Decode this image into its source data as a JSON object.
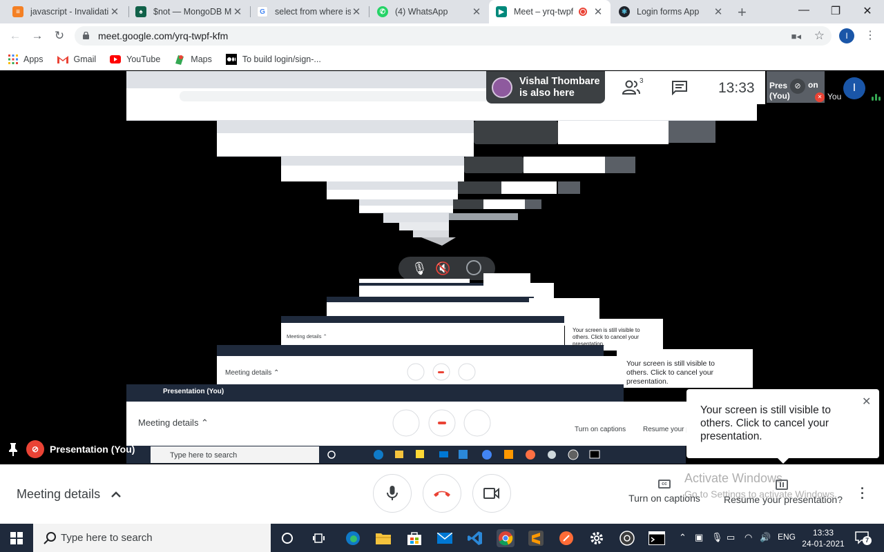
{
  "browser": {
    "tabs": [
      {
        "title": "javascript - Invalidati",
        "icon": "stackoverflow-icon",
        "color": "#f48024"
      },
      {
        "title": "$not — MongoDB M",
        "icon": "mongodb-icon",
        "color": "#13aa52"
      },
      {
        "title": "select from where is",
        "icon": "google-icon",
        "color": "#4285f4"
      },
      {
        "title": "(4) WhatsApp",
        "icon": "whatsapp-icon",
        "color": "#25d366"
      },
      {
        "title": "Meet – yrq-twpf",
        "icon": "meet-icon",
        "color": "#00897b"
      },
      {
        "title": "Login forms App",
        "icon": "react-icon",
        "color": "#61dafb"
      }
    ],
    "url": "meet.google.com/yrq-twpf-kfm",
    "profile_initial": "I",
    "bookmarks": [
      {
        "label": "Apps",
        "icon": "apps-grid-icon"
      },
      {
        "label": "Gmail",
        "icon": "gmail-icon"
      },
      {
        "label": "YouTube",
        "icon": "youtube-icon"
      },
      {
        "label": "Maps",
        "icon": "maps-icon"
      },
      {
        "label": "To build login/sign-...",
        "icon": "medium-icon"
      }
    ]
  },
  "meet": {
    "participant_chip": {
      "line1": "Vishal Thombare",
      "line2": "is also here"
    },
    "people_count": "3",
    "time": "13:33",
    "self_tile": {
      "line1": "Pres",
      "line2": "(You)",
      "line3": "on"
    },
    "you_label": "You",
    "you_initial": "I",
    "presentation_label": "Presentation (You)",
    "warning": {
      "text": "Your screen is still visible to others. Click to cancel your presentation."
    },
    "bottom_bar": {
      "meeting_details": "Meeting details",
      "captions_label": "Turn on captions",
      "resume_label": "Resume your presentation?"
    },
    "activate_windows": {
      "title": "Activate Windows",
      "subtitle": "Go to Settings to activate Windows."
    }
  },
  "taskbar": {
    "search_placeholder": "Type here to search",
    "language": "ENG",
    "time": "13:33",
    "date": "24-01-2021",
    "notification_count": "7"
  }
}
